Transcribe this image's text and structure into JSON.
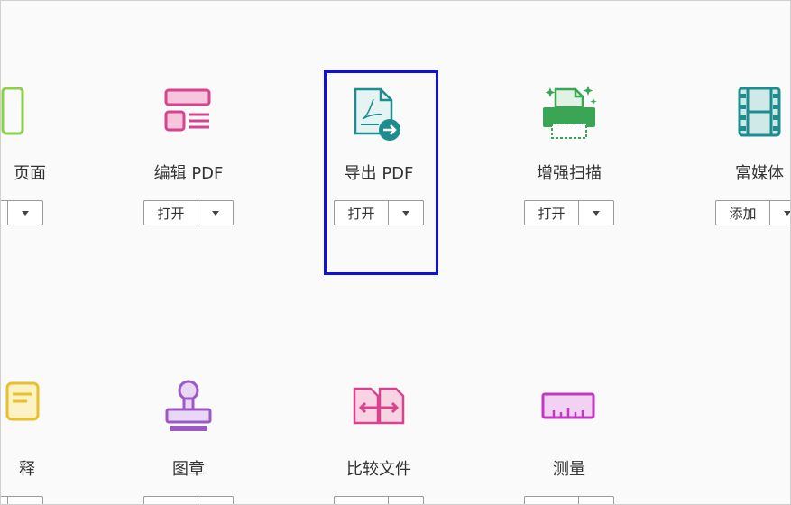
{
  "tools_row1": [
    {
      "label": "页面",
      "button": ""
    },
    {
      "label": "编辑 PDF",
      "button": "打开"
    },
    {
      "label": "导出 PDF",
      "button": "打开"
    },
    {
      "label": "增强扫描",
      "button": "打开"
    },
    {
      "label": "富媒体",
      "button": "添加"
    }
  ],
  "tools_row2": [
    {
      "label": "释"
    },
    {
      "label": "图章"
    },
    {
      "label": "比较文件"
    },
    {
      "label": "测量"
    }
  ],
  "colors": {
    "highlight": "#1010d6",
    "organize_green": "#8bd046",
    "edit_pink": "#d8438d",
    "export_teal": "#1f8c8f",
    "scan_green": "#3aa655",
    "media_teal": "#1f8c8f",
    "comment_yellow": "#e8c02a",
    "stamp_purple": "#9b59c6",
    "compare_pink": "#d8438d",
    "measure_magenta": "#c238c2"
  }
}
